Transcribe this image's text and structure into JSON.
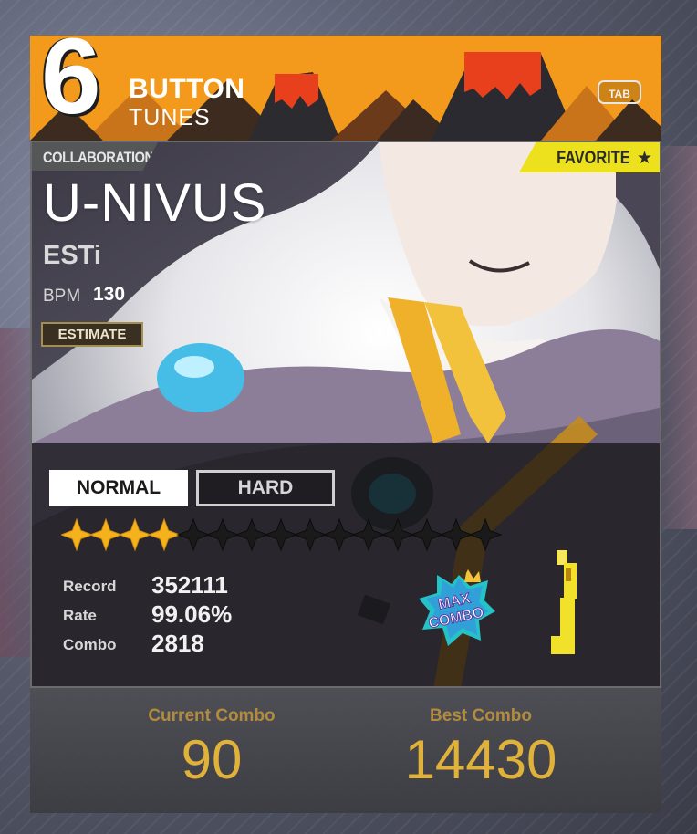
{
  "header": {
    "logo_number": "6",
    "logo_line1": "BUTTON",
    "logo_line2": "TUNES",
    "tab_key": "TAB",
    "bg_color": "#f39a1c"
  },
  "song": {
    "category": "COLLABORATION",
    "favorite_label": "FAVORITE",
    "favorite_icon": "star-icon",
    "title": "U-NIVUS",
    "artist": "ESTi",
    "bpm_label": "BPM",
    "bpm_value": "130",
    "estimate_label": "ESTIMATE"
  },
  "difficulty": {
    "tabs": [
      {
        "label": "NORMAL",
        "selected": true
      },
      {
        "label": "HARD",
        "selected": false
      }
    ],
    "level": 4,
    "max_level": 15,
    "star_color_filled": "#f5b21c"
  },
  "record": {
    "rows": [
      {
        "label": "Record",
        "value": "352111"
      },
      {
        "label": "Rate",
        "value": "99.06%"
      },
      {
        "label": "Combo",
        "value": "2818"
      }
    ],
    "badge_line1": "MAX",
    "badge_line2": "COMBO"
  },
  "footer": {
    "current_combo_label": "Current Combo",
    "current_combo_value": "90",
    "best_combo_label": "Best Combo",
    "best_combo_value": "14430",
    "accent_color": "#e1b23a"
  }
}
